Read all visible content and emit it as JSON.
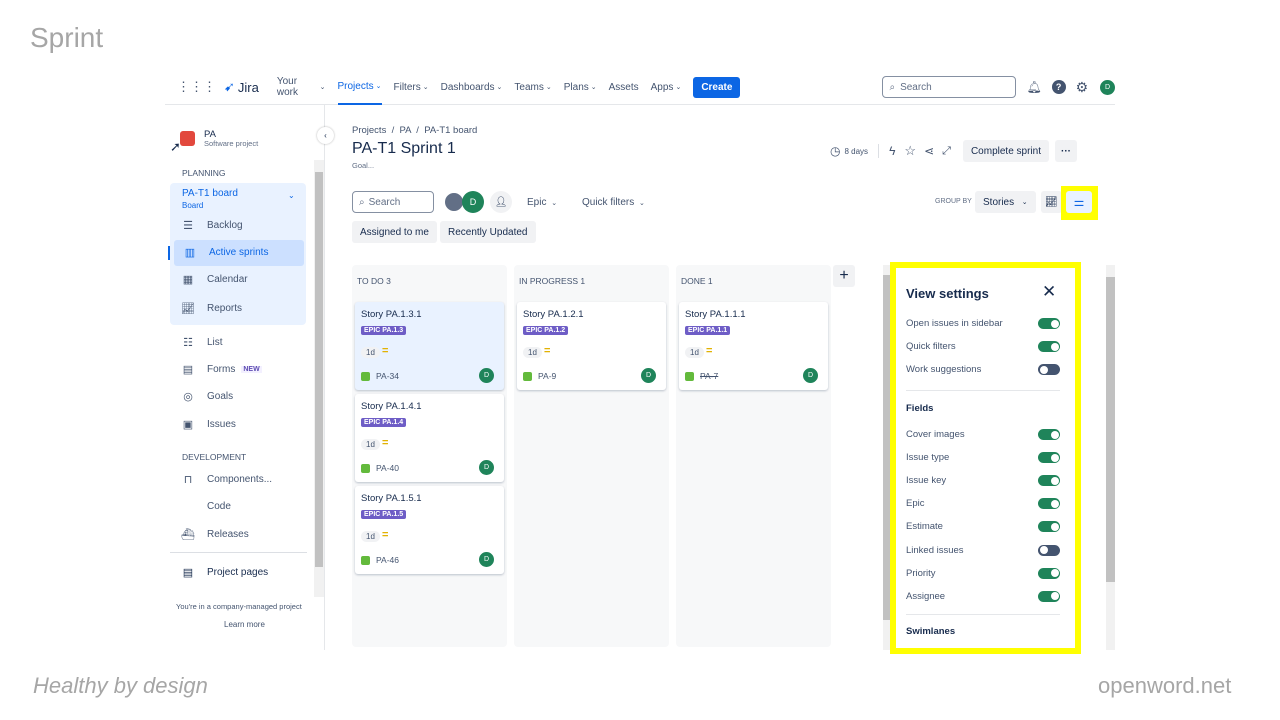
{
  "slide": {
    "title": "Sprint",
    "footer_left": "Healthy by design",
    "footer_right": "openword.net"
  },
  "nav": {
    "logo": "Jira",
    "items": [
      "Your work",
      "Projects",
      "Filters",
      "Dashboards",
      "Teams",
      "Plans",
      "Assets",
      "Apps"
    ],
    "active": "Projects",
    "create": "Create",
    "search_placeholder": "Search",
    "avatar": "D"
  },
  "sidebar": {
    "project_name": "PA",
    "project_type": "Software project",
    "planning_label": "PLANNING",
    "board_name": "PA-T1 board",
    "board_sub": "Board",
    "planning_items": [
      {
        "label": "Backlog",
        "icon": "backlog-icon"
      },
      {
        "label": "Active sprints",
        "icon": "board-icon",
        "active": true
      },
      {
        "label": "Calendar",
        "icon": "calendar-icon"
      },
      {
        "label": "Reports",
        "icon": "reports-icon"
      }
    ],
    "other_items": [
      {
        "label": "List",
        "icon": "list-icon"
      },
      {
        "label": "Forms",
        "icon": "forms-icon",
        "badge": "NEW"
      },
      {
        "label": "Goals",
        "icon": "goals-icon"
      },
      {
        "label": "Issues",
        "icon": "issues-icon"
      }
    ],
    "development_label": "DEVELOPMENT",
    "dev_items": [
      {
        "label": "Components...",
        "icon": "components-icon"
      },
      {
        "label": "Code",
        "icon": "code-icon"
      },
      {
        "label": "Releases",
        "icon": "releases-icon"
      }
    ],
    "project_pages": "Project pages",
    "footer_note": "You're in a company-managed project",
    "learn_more": "Learn more"
  },
  "header": {
    "breadcrumb": [
      "Projects",
      "PA",
      "PA-T1 board"
    ],
    "title": "PA-T1 Sprint 1",
    "goal": "Goal...",
    "days": "8 days",
    "complete_sprint": "Complete sprint"
  },
  "toolbar": {
    "search_placeholder": "Search",
    "avatar": "D",
    "epic": "Epic",
    "quick_filters": "Quick filters",
    "assigned": "Assigned to me",
    "recent": "Recently Updated",
    "group_by_label": "GROUP BY",
    "group_by": "Stories"
  },
  "columns": [
    {
      "title": "TO DO 3",
      "cards": [
        {
          "title": "Story PA.1.3.1",
          "epic": "EPIC PA.1.3",
          "estimate": "1d",
          "key": "PA-34",
          "assignee": "D",
          "selected": true
        },
        {
          "title": "Story PA.1.4.1",
          "epic": "EPIC PA.1.4",
          "estimate": "1d",
          "key": "PA-40",
          "assignee": "D"
        },
        {
          "title": "Story PA.1.5.1",
          "epic": "EPIC PA.1.5",
          "estimate": "1d",
          "key": "PA-46",
          "assignee": "D"
        }
      ]
    },
    {
      "title": "IN PROGRESS 1",
      "cards": [
        {
          "title": "Story PA.1.2.1",
          "epic": "EPIC PA.1.2",
          "estimate": "1d",
          "key": "PA-9",
          "assignee": "D"
        }
      ]
    },
    {
      "title": "DONE 1",
      "cards": [
        {
          "title": "Story PA.1.1.1",
          "epic": "EPIC PA.1.1",
          "estimate": "1d",
          "key": "PA-7",
          "assignee": "D",
          "done": true
        }
      ]
    }
  ],
  "view_settings": {
    "title": "View settings",
    "general": [
      {
        "label": "Open issues in sidebar",
        "on": true
      },
      {
        "label": "Quick filters",
        "on": true
      },
      {
        "label": "Work suggestions",
        "on": false
      }
    ],
    "fields_label": "Fields",
    "fields": [
      {
        "label": "Cover images",
        "on": true
      },
      {
        "label": "Issue type",
        "on": true
      },
      {
        "label": "Issue key",
        "on": true
      },
      {
        "label": "Epic",
        "on": true
      },
      {
        "label": "Estimate",
        "on": true
      },
      {
        "label": "Linked issues",
        "on": false
      },
      {
        "label": "Priority",
        "on": true
      },
      {
        "label": "Assignee",
        "on": true
      }
    ],
    "swimlanes_label": "Swimlanes"
  },
  "colors": {
    "accent": "#0c66e4",
    "highlight": "#ffff00",
    "epic": "#6e5dc6",
    "toggle_on": "#1f845a",
    "avatar": "#1f845a"
  }
}
